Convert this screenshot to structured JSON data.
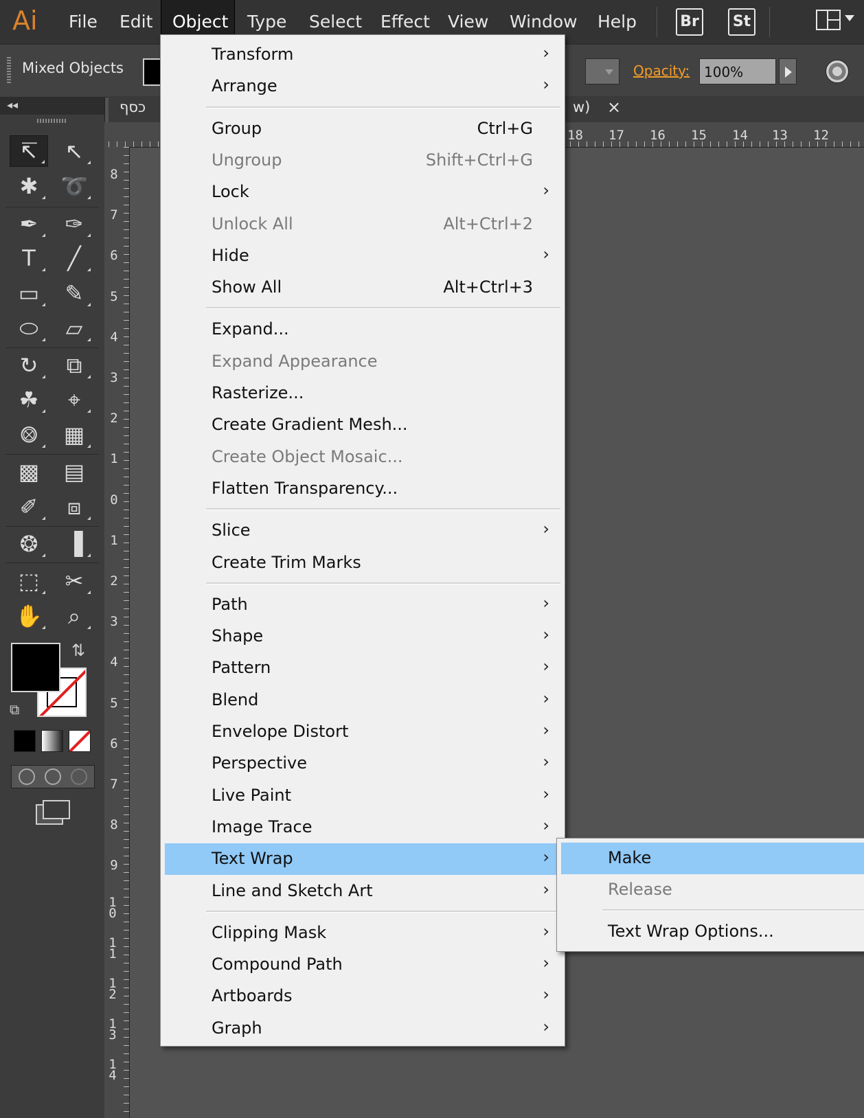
{
  "app": {
    "logo": "Ai"
  },
  "menubar": {
    "items": [
      "File",
      "Edit",
      "Object",
      "Type",
      "Select",
      "Effect",
      "View",
      "Window",
      "Help"
    ],
    "open_item": "Object",
    "bridge_buttons": [
      "Br",
      "St"
    ],
    "workspace_icon": "workspace-switcher-icon"
  },
  "controlbar": {
    "selection_label": "Mixed Objects",
    "opacity_label": "Opacity:",
    "opacity_value": "100%"
  },
  "document": {
    "tab_title_left": "כסף",
    "tab_title_right": "w)",
    "close_glyph": "×",
    "ruler_top_ticks": [
      "18",
      "17",
      "16",
      "15",
      "14",
      "13",
      "12"
    ],
    "ruler_left_ticks": [
      "8",
      "7",
      "6",
      "5",
      "4",
      "3",
      "2",
      "1",
      "0",
      "1",
      "2",
      "3",
      "4",
      "5",
      "6",
      "7",
      "8",
      "9",
      "10",
      "11",
      "12",
      "13",
      "14"
    ]
  },
  "object_menu": {
    "groups": [
      [
        {
          "label": "Transform",
          "submenu": true
        },
        {
          "label": "Arrange",
          "submenu": true
        }
      ],
      [
        {
          "label": "Group",
          "shortcut": "Ctrl+G"
        },
        {
          "label": "Ungroup",
          "shortcut": "Shift+Ctrl+G",
          "disabled": true
        },
        {
          "label": "Lock",
          "submenu": true
        },
        {
          "label": "Unlock All",
          "shortcut": "Alt+Ctrl+2",
          "disabled": true
        },
        {
          "label": "Hide",
          "submenu": true
        },
        {
          "label": "Show All",
          "shortcut": "Alt+Ctrl+3"
        }
      ],
      [
        {
          "label": "Expand..."
        },
        {
          "label": "Expand Appearance",
          "disabled": true
        },
        {
          "label": "Rasterize..."
        },
        {
          "label": "Create Gradient Mesh..."
        },
        {
          "label": "Create Object Mosaic...",
          "disabled": true
        },
        {
          "label": "Flatten Transparency..."
        }
      ],
      [
        {
          "label": "Slice",
          "submenu": true
        },
        {
          "label": "Create Trim Marks"
        }
      ],
      [
        {
          "label": "Path",
          "submenu": true
        },
        {
          "label": "Shape",
          "submenu": true
        },
        {
          "label": "Pattern",
          "submenu": true
        },
        {
          "label": "Blend",
          "submenu": true
        },
        {
          "label": "Envelope Distort",
          "submenu": true
        },
        {
          "label": "Perspective",
          "submenu": true
        },
        {
          "label": "Live Paint",
          "submenu": true
        },
        {
          "label": "Image Trace",
          "submenu": true
        },
        {
          "label": "Text Wrap",
          "submenu": true,
          "highlighted": true
        },
        {
          "label": "Line and Sketch Art",
          "submenu": true
        }
      ],
      [
        {
          "label": "Clipping Mask",
          "submenu": true
        },
        {
          "label": "Compound Path",
          "submenu": true
        },
        {
          "label": "Artboards",
          "submenu": true
        },
        {
          "label": "Graph",
          "submenu": true
        }
      ]
    ]
  },
  "text_wrap_submenu": {
    "items": [
      {
        "label": "Make",
        "highlighted": true
      },
      {
        "label": "Release",
        "disabled": true
      },
      {
        "label": "Text Wrap Options...",
        "separator_before": true
      }
    ]
  },
  "tools": {
    "rows": [
      [
        "selection-tool-icon",
        "direct-selection-tool-icon"
      ],
      [
        "magic-wand-tool-icon",
        "lasso-tool-icon"
      ],
      [
        "pen-tool-icon",
        "curvature-tool-icon"
      ],
      [
        "type-tool-icon",
        "line-segment-tool-icon"
      ],
      [
        "rectangle-tool-icon",
        "paintbrush-tool-icon"
      ],
      [
        "shaper-tool-icon",
        "eraser-tool-icon"
      ],
      [
        "rotate-tool-icon",
        "scale-tool-icon"
      ],
      [
        "warp-tool-icon",
        "free-transform-tool-icon"
      ],
      [
        "shape-builder-tool-icon",
        "perspective-grid-tool-icon"
      ],
      [
        "mesh-tool-icon",
        "gradient-tool-icon"
      ],
      [
        "eyedropper-tool-icon",
        "blend-tool-icon"
      ],
      [
        "symbol-sprayer-tool-icon",
        "column-graph-tool-icon"
      ],
      [
        "artboard-tool-icon",
        "slice-tool-icon"
      ],
      [
        "hand-tool-icon",
        "zoom-tool-icon"
      ]
    ]
  },
  "colors": {
    "menubar_bg": "#333333",
    "panel_bg": "#3c3c3c",
    "menu_bg": "#f0f0f0",
    "highlight": "#91c9f7",
    "opacity_label": "#f39c28",
    "logo": "#d9822b"
  }
}
